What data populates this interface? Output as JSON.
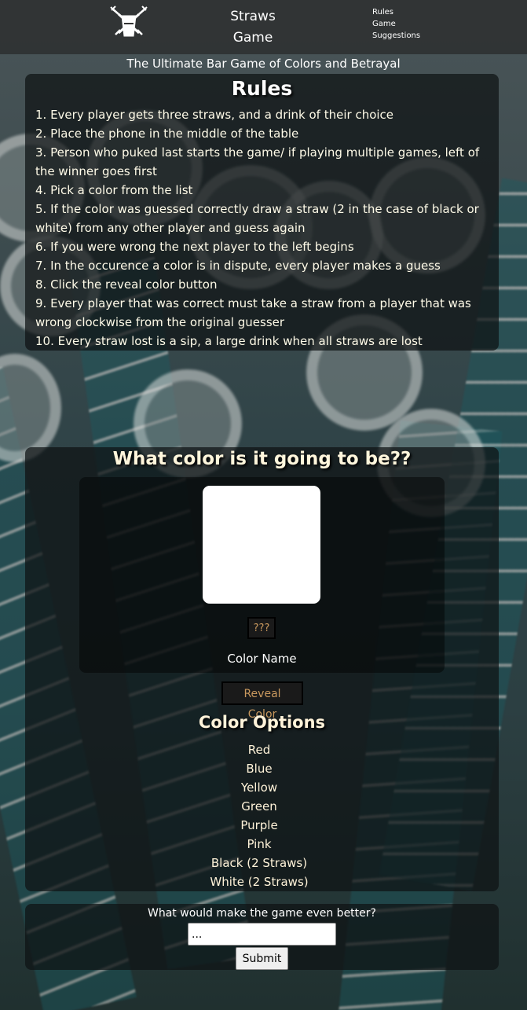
{
  "header": {
    "title_line1": "Straws",
    "title_line2": "Game",
    "nav": [
      "Rules",
      "Game",
      "Suggestions"
    ],
    "logo": "crossed-straws-cup-icon"
  },
  "tagline": "The Ultimate Bar Game of Colors and Betrayal",
  "rules": {
    "title": "Rules",
    "items": [
      "1. Every player gets three straws, and a drink of their choice",
      "2. Place the phone in the middle of the table",
      "3. Person who puked last starts the game/ if playing multiple games, left of the winner goes first",
      "4. Pick a color from the list",
      "5. If the color was guessed correctly draw a straw (2 in the case of black or white) from any other player and guess again",
      "6. If you were wrong the next player to the left begins",
      "7. In the occurence a color is in dispute, every player makes a guess",
      "8. Click the reveal color button",
      "9. Every player that was correct must take a straw from a player that was wrong clockwise from the original guesser",
      "10. Every straw lost is a sip, a large drink when all straws are lost"
    ]
  },
  "game": {
    "title": "What color is it going to be??",
    "swatch_color": "#ffffff",
    "hidden_label": "???",
    "color_name": "Color Name",
    "reveal_button": "Reveal Color",
    "options_title": "Color Options",
    "options": [
      "Red",
      "Blue",
      "Yellow",
      "Green",
      "Purple",
      "Pink",
      "Black (2 Straws)",
      "White (2 Straws)"
    ]
  },
  "suggestions": {
    "question": "What would make the game even better?",
    "input_value": "...",
    "submit": "Submit"
  },
  "colors": {
    "panel_bg": "#0e1213",
    "button_text": "#c8985e",
    "heading_text": "#fff3d9"
  }
}
